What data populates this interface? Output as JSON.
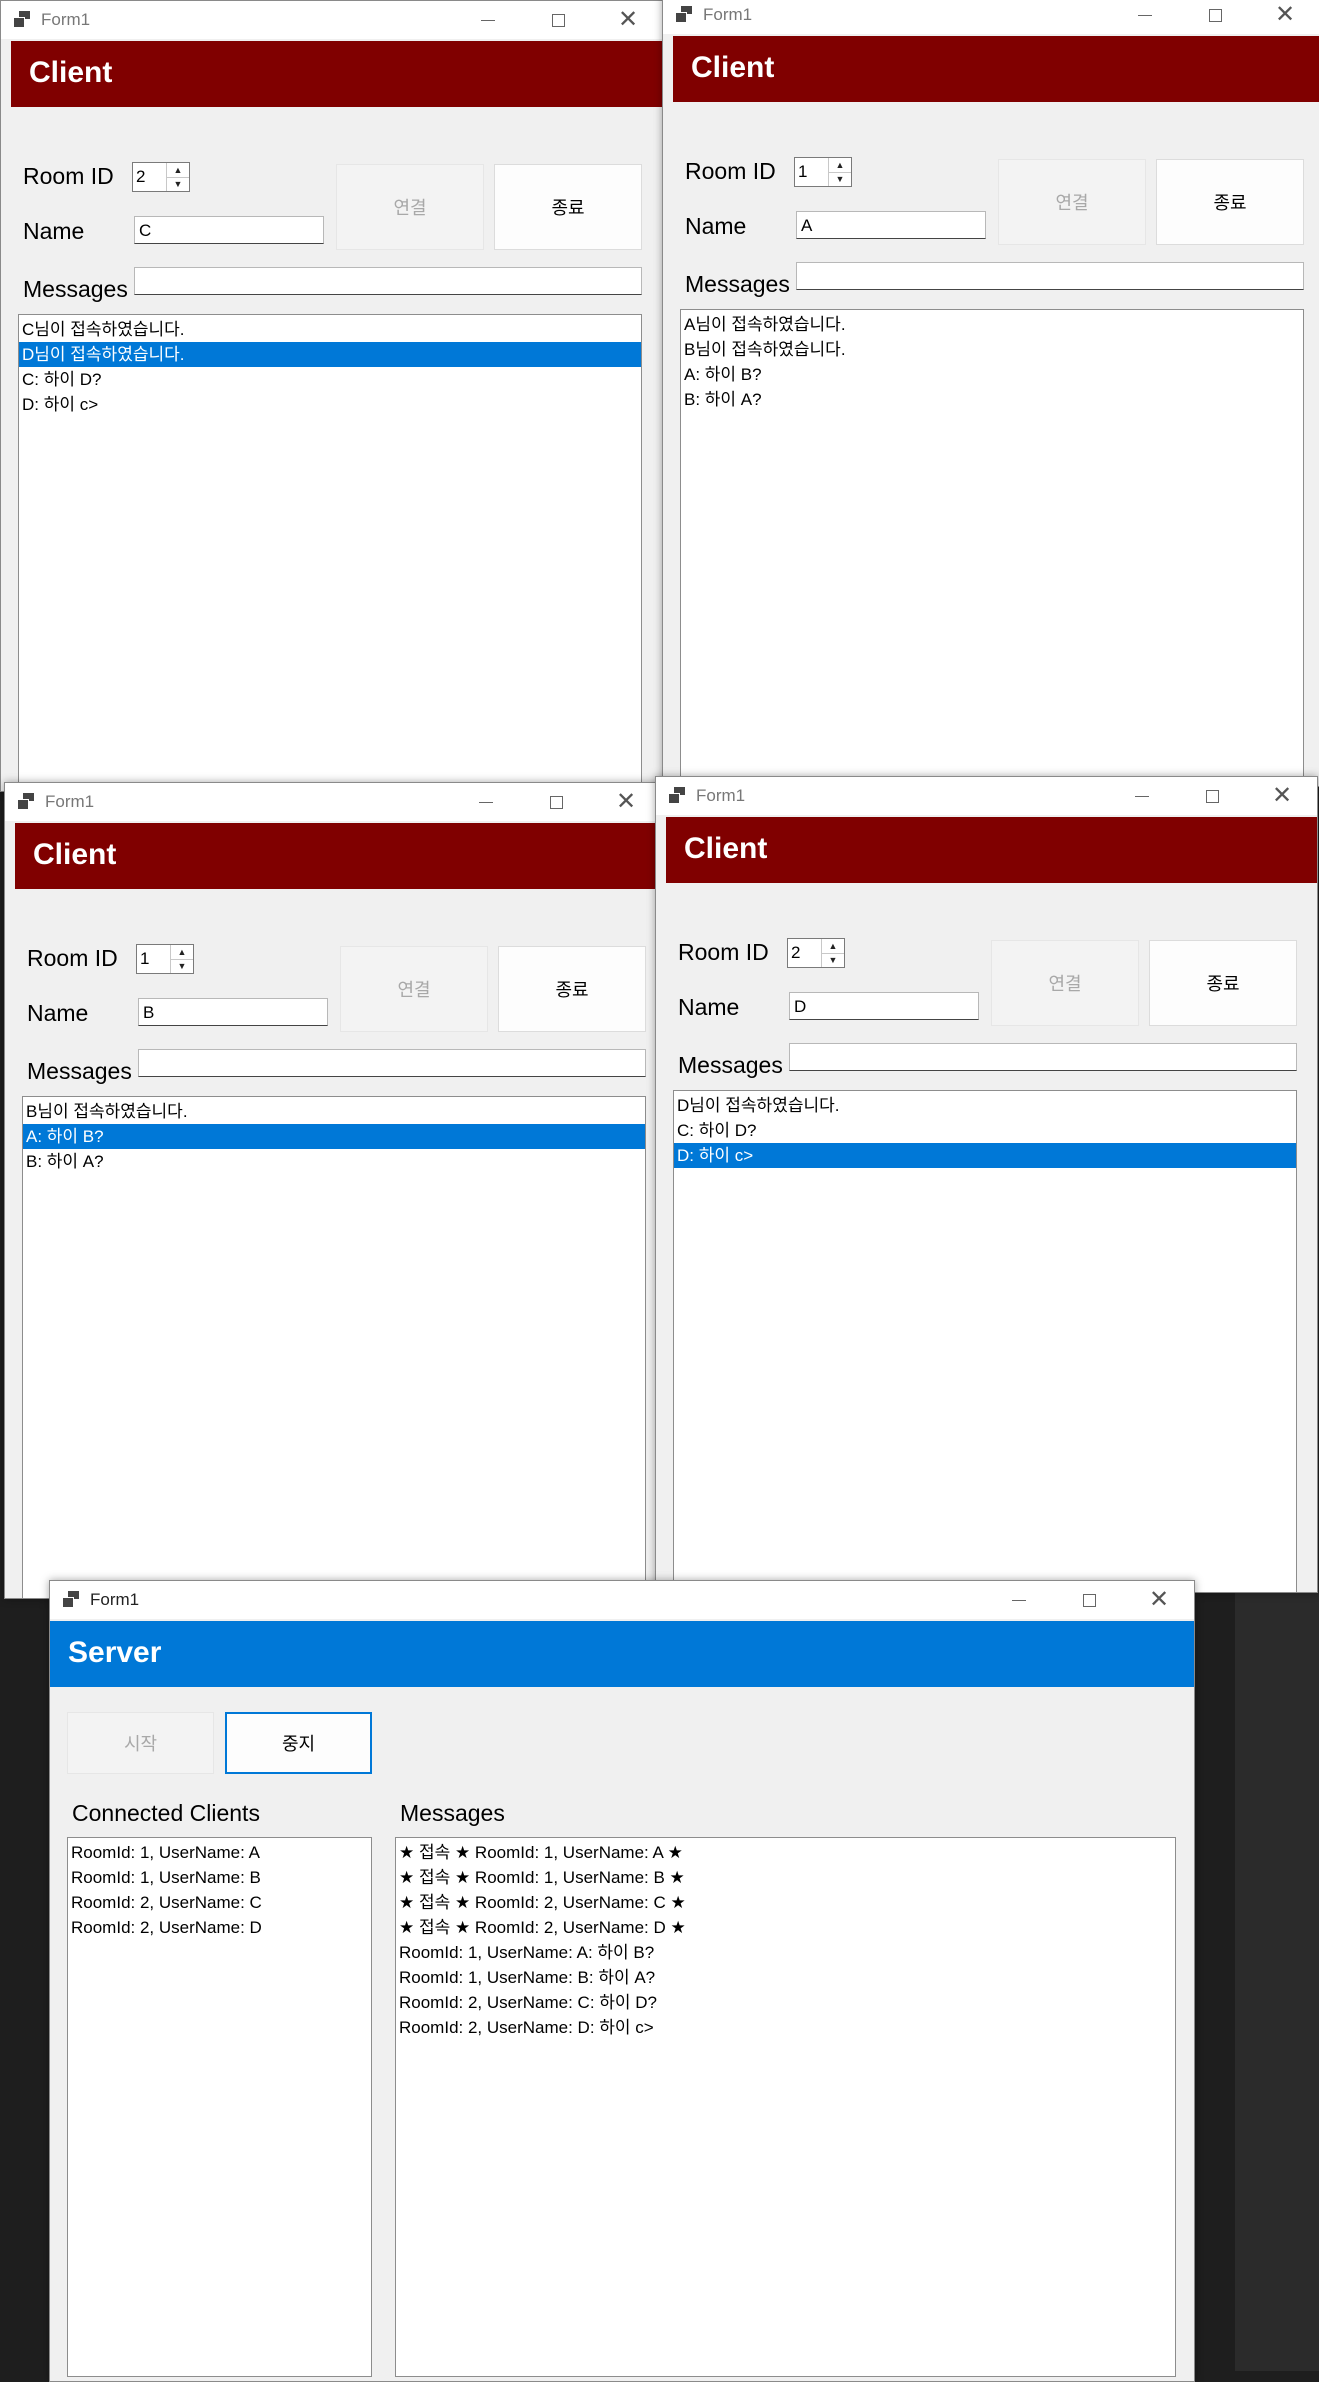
{
  "window_title": "Form1",
  "client_banner": "Client",
  "labels": {
    "room_id": "Room ID",
    "name": "Name",
    "messages": "Messages"
  },
  "buttons": {
    "connect": "연결",
    "exit": "종료"
  },
  "clients": [
    {
      "room_id": "2",
      "name": "C",
      "message_input": "",
      "messages": [
        "C님이 접속하였습니다.",
        "D님이 접속하였습니다.",
        "C: 하이 D?",
        "D: 하이 c>"
      ],
      "selected_index": 1
    },
    {
      "room_id": "1",
      "name": "A",
      "message_input": "",
      "messages": [
        "A님이 접속하였습니다.",
        "B님이 접속하였습니다.",
        "A: 하이 B?",
        "B: 하이 A?"
      ],
      "selected_index": -1
    },
    {
      "room_id": "1",
      "name": "B",
      "message_input": "",
      "messages": [
        "B님이 접속하였습니다.",
        "A: 하이 B?",
        "B: 하이 A?"
      ],
      "selected_index": 1
    },
    {
      "room_id": "2",
      "name": "D",
      "message_input": "",
      "messages": [
        "D님이 접속하였습니다.",
        "C: 하이 D?",
        "D: 하이 c>"
      ],
      "selected_index": 2
    }
  ],
  "server": {
    "banner": "Server",
    "start_label": "시작",
    "stop_label": "중지",
    "connected_clients_label": "Connected Clients",
    "messages_label": "Messages",
    "connected_clients": [
      "RoomId: 1, UserName: A",
      "RoomId: 1, UserName: B",
      "RoomId: 2, UserName: C",
      "RoomId: 2, UserName: D"
    ],
    "messages": [
      "★ 접속 ★ RoomId: 1, UserName: A ★",
      "★ 접속 ★ RoomId: 1, UserName: B ★",
      "★ 접속 ★ RoomId: 2, UserName: C ★",
      "★ 접속 ★ RoomId: 2, UserName: D ★",
      "RoomId: 1, UserName: A: 하이 B?",
      "RoomId: 1, UserName: B: 하이 A?",
      "RoomId: 2, UserName: C: 하이 D?",
      "RoomId: 2, UserName: D: 하이 c>"
    ]
  }
}
